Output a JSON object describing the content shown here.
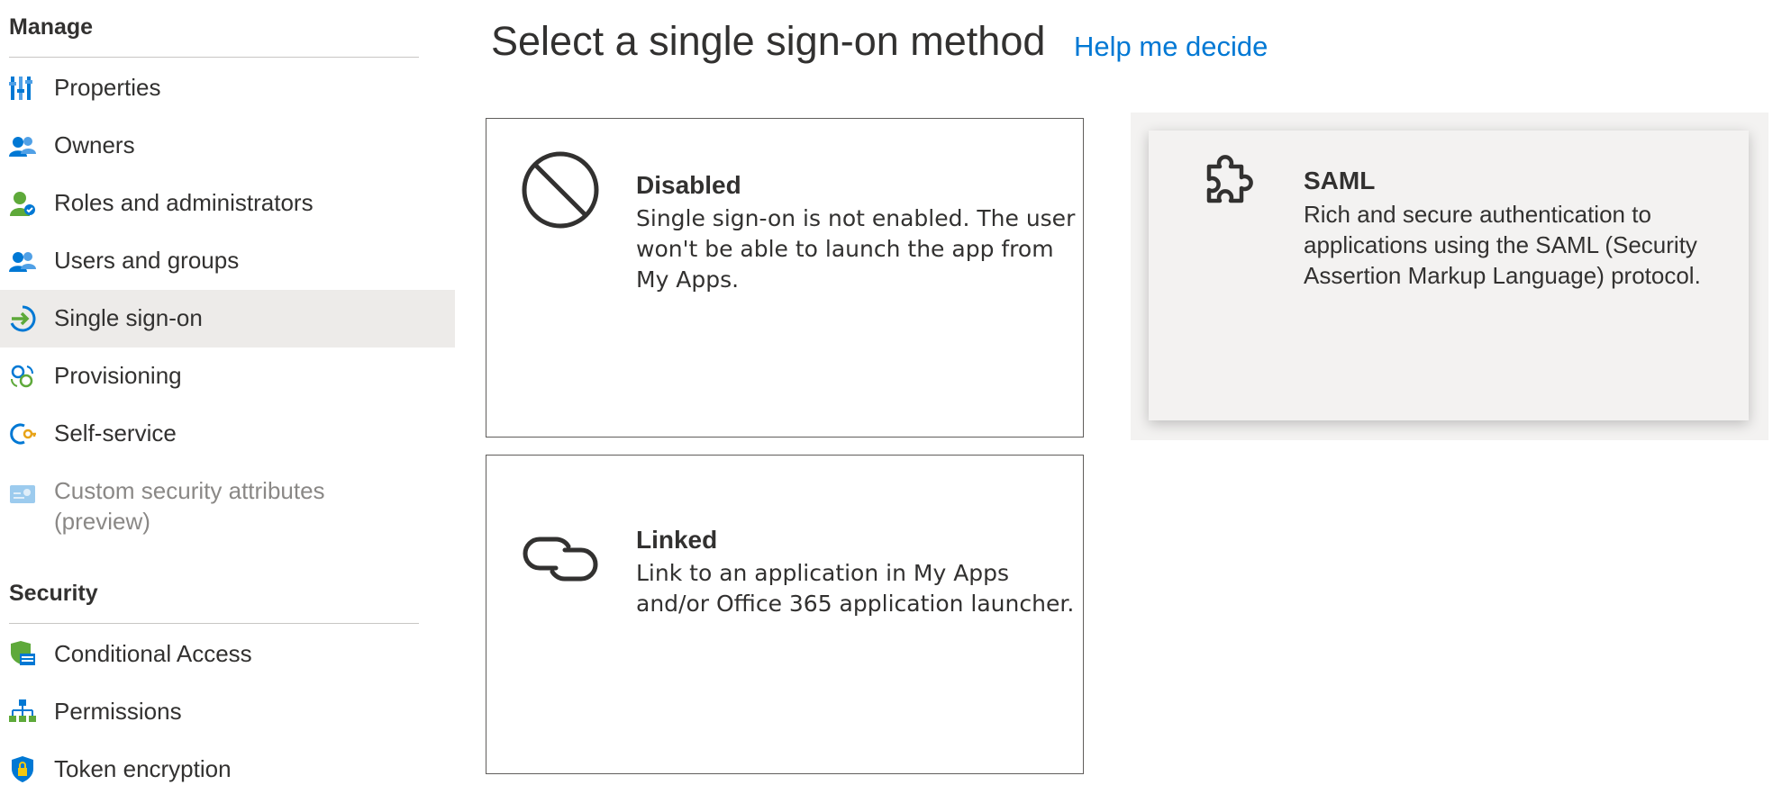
{
  "sidebar": {
    "manage_title": "Manage",
    "security_title": "Security",
    "manage_items": [
      {
        "label": "Properties",
        "icon": "properties-icon"
      },
      {
        "label": "Owners",
        "icon": "owners-icon"
      },
      {
        "label": "Roles and administrators",
        "icon": "roles-icon"
      },
      {
        "label": "Users and groups",
        "icon": "users-groups-icon"
      },
      {
        "label": "Single sign-on",
        "icon": "single-sign-on-icon",
        "selected": true
      },
      {
        "label": "Provisioning",
        "icon": "provisioning-icon"
      },
      {
        "label": "Self-service",
        "icon": "self-service-icon"
      },
      {
        "label": "Custom security attributes (preview)",
        "icon": "custom-security-attributes-icon",
        "disabled": true
      }
    ],
    "security_items": [
      {
        "label": "Conditional Access",
        "icon": "conditional-access-icon"
      },
      {
        "label": "Permissions",
        "icon": "permissions-icon"
      },
      {
        "label": "Token encryption",
        "icon": "token-encryption-icon"
      }
    ]
  },
  "main": {
    "title": "Select a single sign-on method",
    "help_link": "Help me decide",
    "cards": {
      "disabled": {
        "title": "Disabled",
        "description": "Single sign-on is not enabled. The user won't be able to launch the app from My Apps.",
        "icon": "prohibited-icon"
      },
      "saml": {
        "title": "SAML",
        "description": "Rich and secure authentication to applications using the SAML (Security Assertion Markup Language) protocol.",
        "icon": "puzzle-icon",
        "selected": true
      },
      "linked": {
        "title": "Linked",
        "description": "Link to an application in My Apps and/or Office 365 application launcher.",
        "icon": "link-icon"
      }
    }
  },
  "colors": {
    "accent": "#0078d4",
    "selected_bg": "#edebe9",
    "card_border": "#605e5c",
    "saml_bg": "#f3f2f1"
  }
}
